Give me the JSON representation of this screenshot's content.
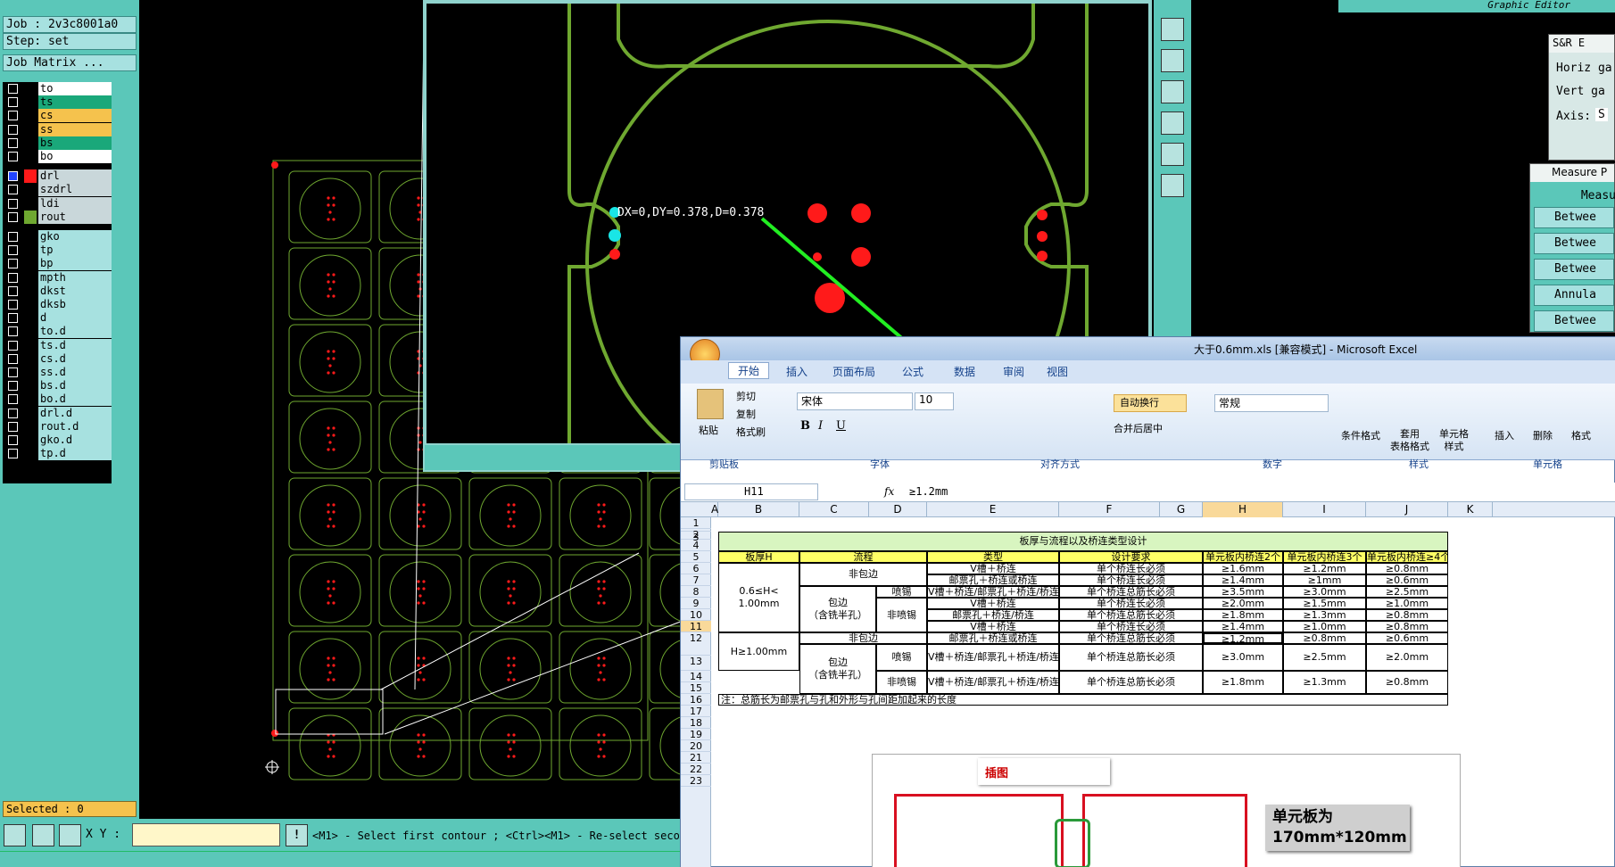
{
  "genesis": {
    "job": "Job : 2v3c8001a0",
    "step": "Step: set",
    "job_matrix": "Job Matrix ...",
    "layers": [
      {
        "name": "to",
        "color": "#ffffff"
      },
      {
        "name": "ts",
        "color": "#1aa87a"
      },
      {
        "name": "cs",
        "color": "#f5c24d"
      },
      {
        "name": "ss",
        "color": "#f5c24d"
      },
      {
        "name": "bs",
        "color": "#1aa87a"
      },
      {
        "name": "bo",
        "color": "#ffffff"
      },
      {
        "name": "drl",
        "color": "#c9d7da"
      },
      {
        "name": "szdrl",
        "color": "#c9d7da"
      },
      {
        "name": "ldi",
        "color": "#c9d7da"
      },
      {
        "name": "rout",
        "color": "#c9d7da"
      },
      {
        "name": "gko",
        "color": "#a7e1e0"
      },
      {
        "name": "tp",
        "color": "#a7e1e0"
      },
      {
        "name": "bp",
        "color": "#a7e1e0"
      },
      {
        "name": "mpth",
        "color": "#a7e1e0"
      },
      {
        "name": "dkst",
        "color": "#a7e1e0"
      },
      {
        "name": "dksb",
        "color": "#a7e1e0"
      },
      {
        "name": "d",
        "color": "#a7e1e0"
      },
      {
        "name": "to.d",
        "color": "#a7e1e0"
      },
      {
        "name": "ts.d",
        "color": "#a7e1e0"
      },
      {
        "name": "cs.d",
        "color": "#a7e1e0"
      },
      {
        "name": "ss.d",
        "color": "#a7e1e0"
      },
      {
        "name": "bs.d",
        "color": "#a7e1e0"
      },
      {
        "name": "bo.d",
        "color": "#a7e1e0"
      },
      {
        "name": "drl.d",
        "color": "#a7e1e0"
      },
      {
        "name": "rout.d",
        "color": "#a7e1e0"
      },
      {
        "name": "gko.d",
        "color": "#a7e1e0"
      },
      {
        "name": "tp.d",
        "color": "#a7e1e0"
      }
    ],
    "selected": "Selected : 0",
    "xy_label": "X Y :",
    "xy_value": "",
    "prompt": "<M1> - Select first contour ; <Ctrl><M1> - Re-select second",
    "measure_readout": "DX=0,DY=0.378,D=0.378",
    "graphic_editor": "Graphic Editor"
  },
  "sr_panel": {
    "title": "S&R E",
    "horiz": "Horiz ga",
    "vert": "Vert  ga",
    "axis": "Axis:",
    "axis_val": "S"
  },
  "measure_panel": {
    "title": "Measure P",
    "header": "Measu",
    "items": [
      "Betwee",
      "Betwee",
      "Betwee",
      "Annula",
      "Betwee"
    ]
  },
  "excel": {
    "title": "大于0.6mm.xls [兼容模式] - Microsoft Excel",
    "tabs": [
      "开始",
      "插入",
      "页面布局",
      "公式",
      "数据",
      "审阅",
      "视图"
    ],
    "clipboard": {
      "paste": "粘贴",
      "cut": "剪切",
      "copy": "复制",
      "format_painter": "格式刷",
      "group": "剪贴板"
    },
    "font": {
      "name": "宋体",
      "size": "10",
      "group": "字体"
    },
    "alignment": {
      "wrap": "自动换行",
      "merge": "合并后居中",
      "group": "对齐方式"
    },
    "number": {
      "format": "常规",
      "group": "数字"
    },
    "styles": {
      "cond": "条件格式",
      "table": "套用\n表格格式",
      "cell": "单元格\n样式",
      "group": "样式"
    },
    "cells": {
      "insert": "插入",
      "delete": "删除",
      "format": "格式",
      "group": "单元格"
    },
    "name_box": "H11",
    "fx": "fx",
    "formula": "≥1.2mm",
    "columns": [
      "A",
      "B",
      "C",
      "D",
      "E",
      "F",
      "G",
      "H",
      "I",
      "J",
      "K"
    ],
    "rows": [
      "1",
      "2",
      "3",
      "4",
      "5",
      "6",
      "7",
      "8",
      "9",
      "10",
      "11",
      "12",
      "13",
      "14",
      "15",
      "16",
      "17",
      "18",
      "19",
      "20",
      "21",
      "22",
      "23"
    ],
    "table": {
      "title": "板厚与流程以及桥连类型设计",
      "headers": [
        "板厚H",
        "流程",
        "类型",
        "设计要求",
        "单元板内桥连2个",
        "单元板内桥连3个",
        "单元板内桥连≥4个"
      ],
      "thick1": "0.6≤H<\n1.00mm",
      "thick2": "H≥1.00mm",
      "nonwrap": "非包边",
      "wrap": "包边\n（含铣半孔）",
      "spray": "喷锡",
      "nospray": "非喷锡",
      "rows": [
        [
          "V槽＋桥连",
          "单个桥连长必须",
          "≥1.6mm",
          "≥1.2mm",
          "≥0.8mm"
        ],
        [
          "邮票孔＋桥连或桥连",
          "单个桥连长必须",
          "≥1.4mm",
          "≥1mm",
          "≥0.6mm"
        ],
        [
          "V槽＋桥连/邮票孔＋桥连/桥连",
          "单个桥连总筋长必须",
          "≥3.5mm",
          "≥3.0mm",
          "≥2.5mm"
        ],
        [
          "V槽＋桥连",
          "单个桥连长必须",
          "≥2.0mm",
          "≥1.5mm",
          "≥1.0mm"
        ],
        [
          "邮票孔＋桥连/桥连",
          "单个桥连总筋长必须",
          "≥1.8mm",
          "≥1.3mm",
          "≥0.8mm"
        ],
        [
          "V槽＋桥连",
          "单个桥连长必须",
          "≥1.4mm",
          "≥1.0mm",
          "≥0.8mm"
        ],
        [
          "邮票孔＋桥连或桥连",
          "单个桥连总筋长必须",
          "≥1.2mm",
          "≥0.8mm",
          "≥0.6mm"
        ],
        [
          "V槽＋桥连/邮票孔＋桥连/桥连",
          "单个桥连总筋长必须",
          "≥3.0mm",
          "≥2.5mm",
          "≥2.0mm"
        ],
        [
          "V槽＋桥连/邮票孔＋桥连/桥连",
          "单个桥连总筋长必须",
          "≥1.8mm",
          "≥1.3mm",
          "≥0.8mm"
        ]
      ],
      "note": "注：总筋长为邮票孔与孔和外形与孔间距加起来的长度"
    },
    "insert_label": "插图",
    "callout": "单元板为\n170mm*120mm"
  }
}
